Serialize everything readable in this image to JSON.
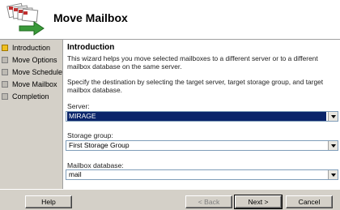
{
  "header": {
    "title": "Move Mailbox",
    "icon": "move-mailbox-wizard-icon"
  },
  "steps": [
    {
      "label": "Introduction",
      "active": true
    },
    {
      "label": "Move Options",
      "active": false
    },
    {
      "label": "Move Schedule",
      "active": false
    },
    {
      "label": "Move Mailbox",
      "active": false
    },
    {
      "label": "Completion",
      "active": false
    }
  ],
  "content": {
    "section_title": "Introduction",
    "intro_text": "This wizard helps you move selected mailboxes to a different server or to a different mailbox database on the same server.",
    "instruction_text": "Specify the destination by selecting the target server, target storage group, and target mailbox database.",
    "server": {
      "label": "Server:",
      "value": "MIRAGE"
    },
    "storage_group": {
      "label": "Storage group:",
      "value": "First Storage Group"
    },
    "mailbox_database": {
      "label": "Mailbox database:",
      "value": "mail"
    }
  },
  "buttons": {
    "help": "Help",
    "back": "< Back",
    "next": "Next >",
    "cancel": "Cancel"
  },
  "colors": {
    "selection": "#0a246a",
    "active_step": "#f0c020",
    "dialog_bg": "#d4d0c8"
  }
}
